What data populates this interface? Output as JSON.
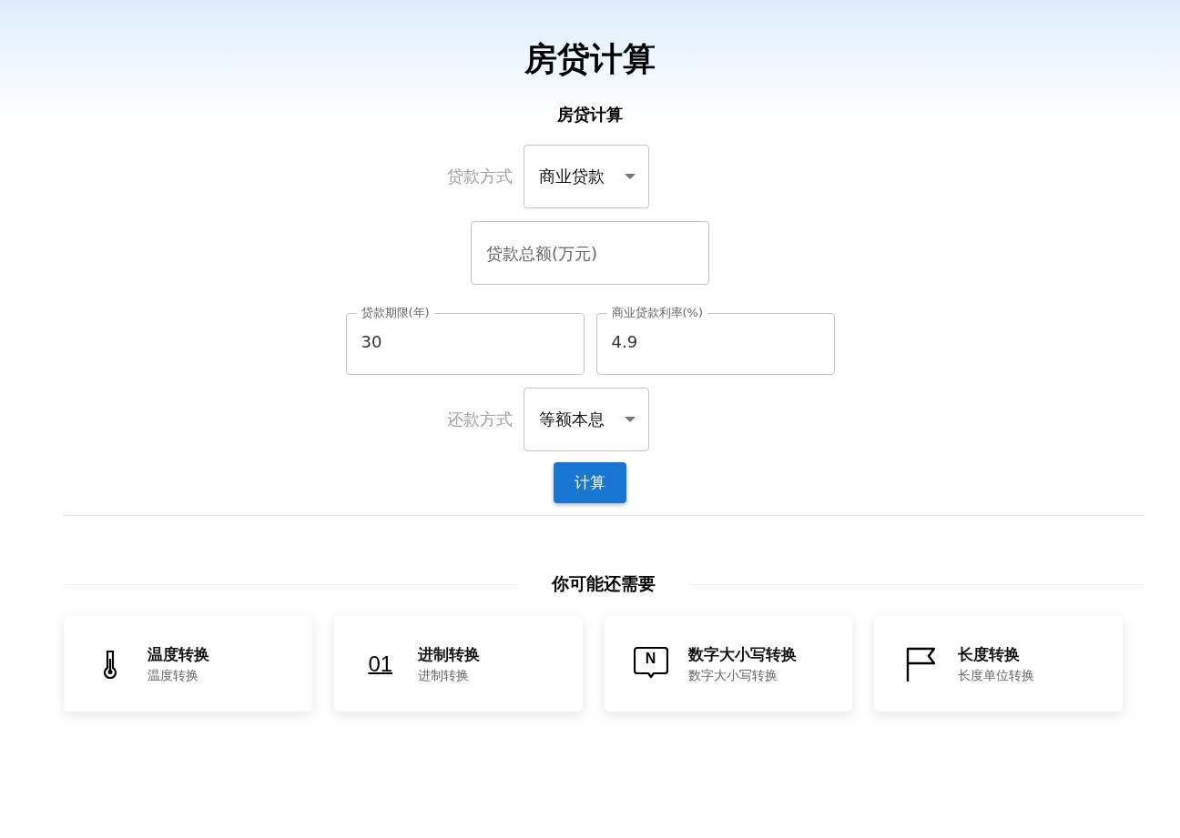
{
  "page_title": "房贷计算",
  "form": {
    "title": "房贷计算",
    "loan_type": {
      "label": "贷款方式",
      "value": "商业贷款"
    },
    "amount": {
      "placeholder": "贷款总额(万元)"
    },
    "term": {
      "label": "贷款期限(年)",
      "value": "30"
    },
    "rate": {
      "label": "商业贷款利率(%)",
      "value": "4.9"
    },
    "repayment": {
      "label": "还款方式",
      "value": "等额本息"
    },
    "submit": "计算"
  },
  "related": {
    "heading": "你可能还需要",
    "cards": [
      {
        "icon": {
          "kind": "thermometer"
        },
        "title": "温度转换",
        "subtitle": "温度转换"
      },
      {
        "icon": {
          "kind": "digits",
          "text": "01"
        },
        "title": "进制转换",
        "subtitle": "进制转换"
      },
      {
        "icon": {
          "kind": "bubble",
          "text": "N"
        },
        "title": "数字大小写转换",
        "subtitle": "数字大小写转换"
      },
      {
        "icon": {
          "kind": "flag"
        },
        "title": "长度转换",
        "subtitle": "长度单位转换"
      }
    ]
  }
}
